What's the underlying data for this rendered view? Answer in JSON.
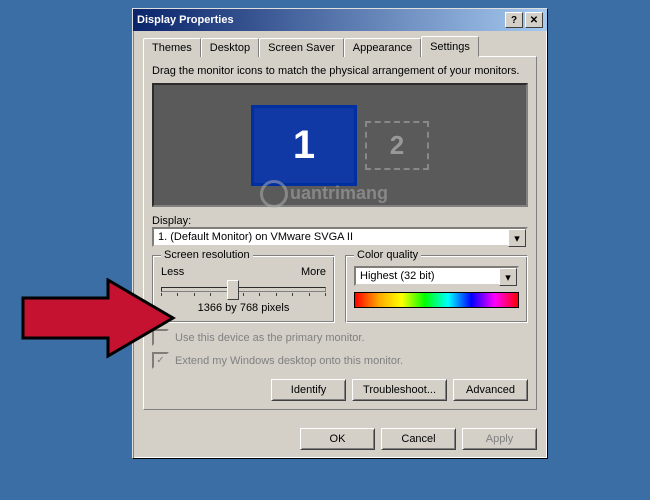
{
  "window": {
    "title": "Display Properties"
  },
  "tabs": [
    "Themes",
    "Desktop",
    "Screen Saver",
    "Appearance",
    "Settings"
  ],
  "activeTab": "Settings",
  "settings": {
    "instruction": "Drag the monitor icons to match the physical arrangement of your monitors.",
    "monitor1": "1",
    "monitor2": "2",
    "displayLabel": "Display:",
    "displayValue": "1. (Default Monitor) on VMware SVGA II",
    "resolution": {
      "title": "Screen resolution",
      "less": "Less",
      "more": "More",
      "value": "1366 by 768 pixels"
    },
    "colorQuality": {
      "title": "Color quality",
      "value": "Highest (32 bit)"
    },
    "primaryCheck": "Use this device as the primary monitor.",
    "extendCheck": "Extend my Windows desktop onto this monitor.",
    "buttons": {
      "identify": "Identify",
      "troubleshoot": "Troubleshoot...",
      "advanced": "Advanced"
    }
  },
  "dialogButtons": {
    "ok": "OK",
    "cancel": "Cancel",
    "apply": "Apply"
  },
  "watermark": "uantrimang"
}
